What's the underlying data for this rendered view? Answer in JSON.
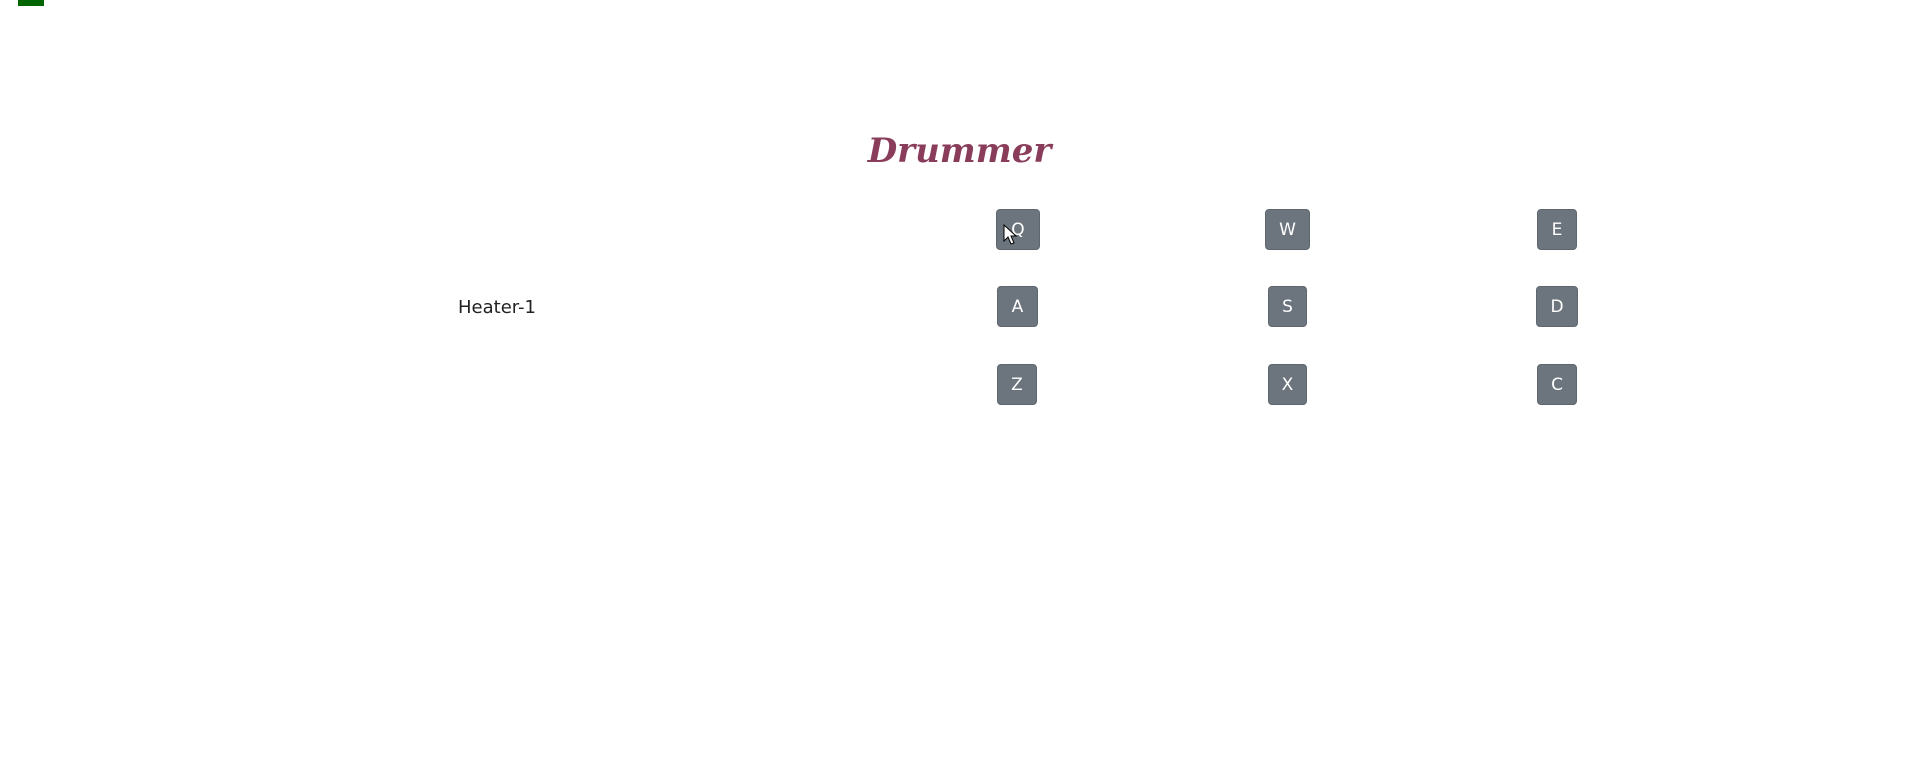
{
  "app": {
    "title": "Drummer",
    "title_color": "#8a3d5b",
    "accent_color": "#006400"
  },
  "display": {
    "text": "Heater-1"
  },
  "pads": {
    "row1": [
      {
        "key": "Q"
      },
      {
        "key": "W"
      },
      {
        "key": "E"
      }
    ],
    "row2": [
      {
        "key": "A"
      },
      {
        "key": "S"
      },
      {
        "key": "D"
      }
    ],
    "row3": [
      {
        "key": "Z"
      },
      {
        "key": "X"
      },
      {
        "key": "C"
      }
    ],
    "pad_color": "#6c757d"
  }
}
